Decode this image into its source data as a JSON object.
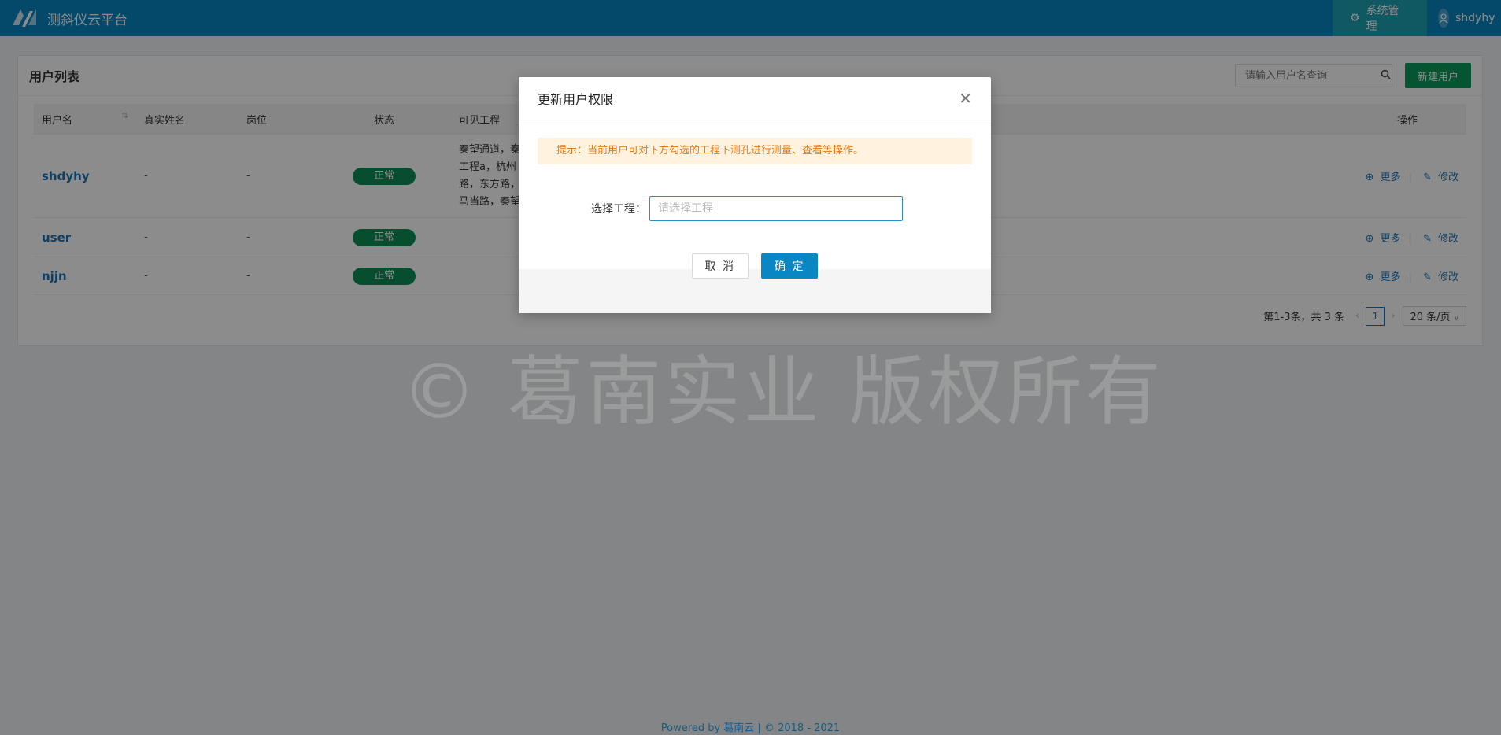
{
  "header": {
    "app_title": "测斜仪云平台",
    "system_label": "系统管理",
    "username": "shdyhy"
  },
  "card": {
    "title": "用户列表",
    "search_placeholder": "请输入用户名查询",
    "new_user_label": "新建用户"
  },
  "table": {
    "columns": [
      "用户名",
      "真实姓名",
      "岗位",
      "状态",
      "可见工程",
      "操作"
    ],
    "rows": [
      {
        "username": "shdyhy",
        "realname": "-",
        "position": "-",
        "status": "正常",
        "projects": [
          "秦望通道，秦",
          "工程a，杭州",
          "路，东方路，",
          "马当路，秦望"
        ]
      },
      {
        "username": "user",
        "realname": "-",
        "position": "-",
        "status": "正常",
        "projects": []
      },
      {
        "username": "njjn",
        "realname": "-",
        "position": "-",
        "status": "正常",
        "projects": []
      }
    ],
    "op_more": "更多",
    "op_edit": "修改"
  },
  "pager": {
    "summary": "第1-3条，共 3 条",
    "current_page": "1",
    "page_size": "20 条/页"
  },
  "watermark": "©   葛南实业 版权所有",
  "footer": {
    "prefix": "Powered by ",
    "brand": "葛南云",
    "suffix": " | © 2018 - 2021"
  },
  "modal": {
    "title": "更新用户权限",
    "notice": "提示：当前用户可对下方勾选的工程下测孔进行测量、查看等操作。",
    "field_label": "选择工程：",
    "field_placeholder": "请选择工程",
    "cancel_label": "取 消",
    "ok_label": "确 定"
  }
}
